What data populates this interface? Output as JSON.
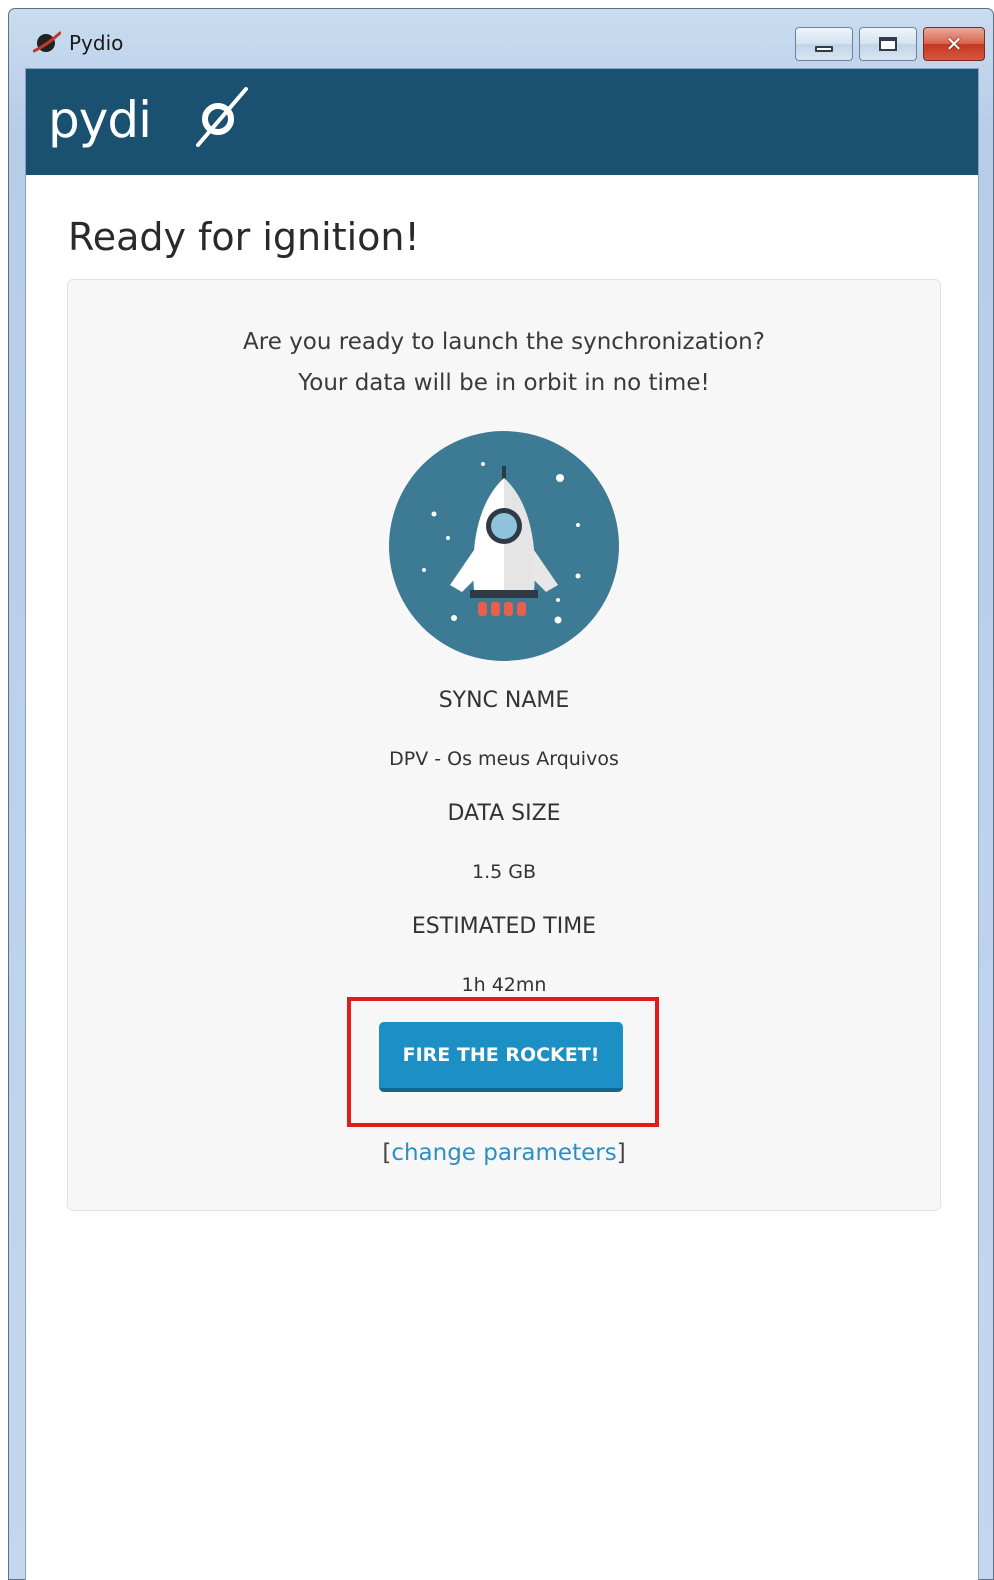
{
  "window": {
    "title": "Pydio"
  },
  "header": {
    "logo_text": "pydio",
    "brand_color": "#1b5170"
  },
  "page": {
    "title": "Ready for ignition!",
    "intro_line1": "Are you ready to launch the synchronization?",
    "intro_line2": "Your data will be in orbit in no time!"
  },
  "summary": {
    "sync_name_label": "SYNC NAME",
    "sync_name_value": "DPV - Os meus Arquivos",
    "data_size_label": "DATA SIZE",
    "data_size_value": "1.5 GB",
    "estimated_time_label": "ESTIMATED TIME",
    "estimated_time_value": "1h 42mn"
  },
  "actions": {
    "fire_label": "FIRE THE ROCKET!",
    "change_prefix": "[",
    "change_link": "change parameters",
    "change_suffix": "]"
  },
  "colors": {
    "accent": "#1c8fc4",
    "highlight_border": "#e21b1b",
    "rocket_circle": "#3d7a94"
  },
  "icons": {
    "app": "pydio-planet-icon",
    "rocket": "rocket-illustration"
  }
}
